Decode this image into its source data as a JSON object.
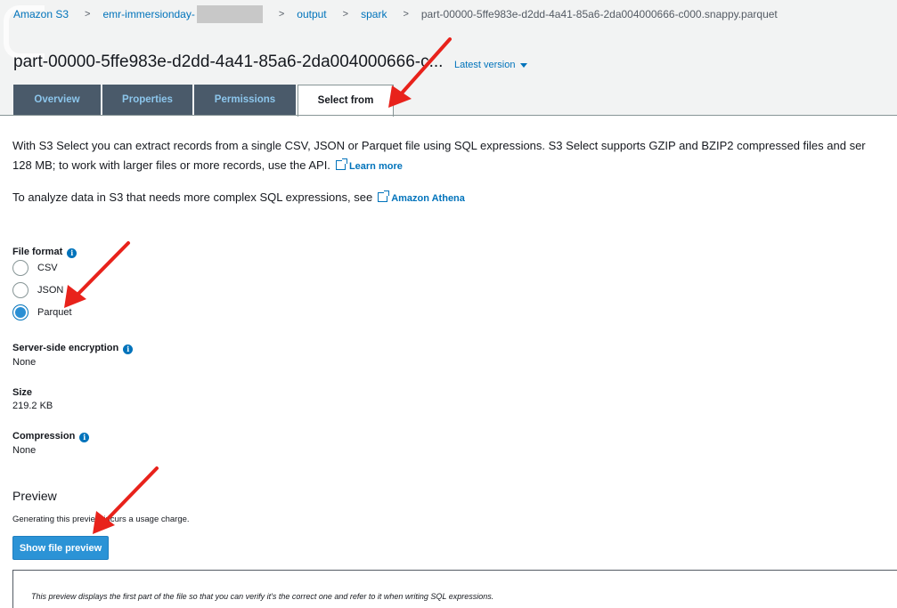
{
  "breadcrumbs": {
    "items": [
      {
        "label": "Amazon S3"
      },
      {
        "label": "emr-immersionday-"
      },
      {
        "label": "output"
      },
      {
        "label": "spark"
      },
      {
        "label": "part-00000-5ffe983e-d2dd-4a41-85a6-2da004000666-c000.snappy.parquet"
      }
    ],
    "separator": ">"
  },
  "header": {
    "title": "part-00000-5ffe983e-d2dd-4a41-85a6-2da004000666-c...",
    "version_label": "Latest version"
  },
  "tabs": [
    {
      "label": "Overview",
      "active": false
    },
    {
      "label": "Properties",
      "active": false
    },
    {
      "label": "Permissions",
      "active": false
    },
    {
      "label": "Select from",
      "active": true
    }
  ],
  "intro": {
    "text": "With S3 Select you can extract records from a single CSV, JSON or Parquet file using SQL expressions. S3 Select supports GZIP and BZIP2 compressed files and ser",
    "text2": "128 MB; to work with larger files or more records, use the API.",
    "learn_more": "Learn more",
    "athena_text": "To analyze data in S3 that needs more complex SQL expressions, see",
    "athena_link": "Amazon Athena"
  },
  "file_format": {
    "label": "File format",
    "options": [
      {
        "label": "CSV",
        "checked": false
      },
      {
        "label": "JSON",
        "checked": false
      },
      {
        "label": "Parquet",
        "checked": true
      }
    ]
  },
  "encryption": {
    "label": "Server-side encryption",
    "value": "None"
  },
  "size": {
    "label": "Size",
    "value": "219.2 KB"
  },
  "compression": {
    "label": "Compression",
    "value": "None"
  },
  "preview": {
    "heading": "Preview",
    "note": "Generating this preview incurs a usage charge.",
    "button_label": "Show file preview",
    "box_text": "This preview displays the first part of the file so that you can verify it's the correct one and refer to it when writing SQL expressions."
  },
  "colors": {
    "link": "#0073bb",
    "primary_button": "#2b93d6",
    "tab_inactive_bg": "#4a5a6a",
    "annotation_arrow": "#e8221b"
  },
  "icons": {
    "info": "info-icon",
    "external_link": "external-link-icon",
    "dropdown": "chevron-down-icon"
  }
}
